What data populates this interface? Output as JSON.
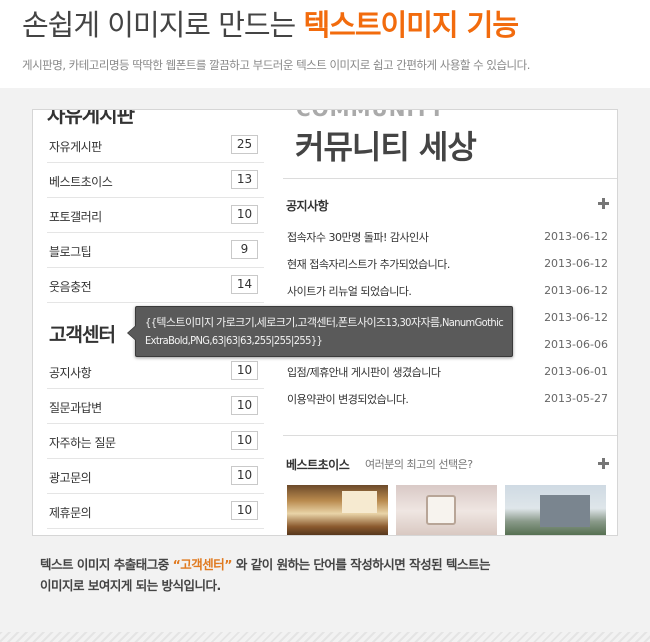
{
  "header": {
    "title_main": "손쉽게 이미지로 만드는 ",
    "title_accent": "텍스트이미지 기능",
    "subtitle": "게시판명, 카테고리명등 딱딱한 웹폰트를 깔끔하고 부드러운 텍스트 이미지로 쉽고 간편하게 사용할 수 있습니다."
  },
  "left_panel": {
    "top_title_cut": "자유게시판",
    "board_items": [
      {
        "label": "자유게시판",
        "count": "25"
      },
      {
        "label": "베스트초이스",
        "count": "13"
      },
      {
        "label": "포토갤러리",
        "count": "10"
      },
      {
        "label": "블로그팁",
        "count": "9"
      },
      {
        "label": "웃음충전",
        "count": "14"
      }
    ],
    "cs_title": "고객센터",
    "cs_items": [
      {
        "label": "공지사항",
        "count": "10"
      },
      {
        "label": "질문과답변",
        "count": "10"
      },
      {
        "label": "자주하는 질문",
        "count": "10"
      },
      {
        "label": "광고문의",
        "count": "10"
      },
      {
        "label": "제휴문의",
        "count": "10"
      }
    ]
  },
  "community": {
    "title_en": "COMMUNITY",
    "title_ko": "커뮤니티 세상",
    "notice_title": "공지사항",
    "notices": [
      {
        "title": "접속자수 30만명 돌파! 감사인사",
        "date": "2013-06-12"
      },
      {
        "title": "현재 접속자리스트가 추가되었습니다.",
        "date": "2013-06-12"
      },
      {
        "title": "사이트가 리뉴얼 되었습니다.",
        "date": "2013-06-12"
      },
      {
        "title": "",
        "date": "2013-06-12"
      },
      {
        "title": "",
        "date": "2013-06-06"
      },
      {
        "title": "입점/제휴안내 게시판이 생겼습니다",
        "date": "2013-06-01"
      },
      {
        "title": "이용약관이 변경되었습니다.",
        "date": "2013-05-27"
      }
    ],
    "best_title": "베스트초이스",
    "best_subtitle": "여러분의 최고의 선택은?"
  },
  "tooltip": {
    "text": "{{텍스트이미지 가로크기,세로크기,고객센터,폰트사이즈13,30자자름,NanumGothicExtraBold,PNG,63|63|63,255|255|255}}"
  },
  "explain": {
    "line1_pre": "텍스트 이미지 추출태그중 ",
    "quote_open": "“",
    "keyword": "고객센터",
    "quote_close": "”",
    "line1_post": " 와 같이 원하는 단어를 작성하시면 작성된 텍스트는",
    "line2": "이미지로 보여지게 되는 방식입니다."
  }
}
